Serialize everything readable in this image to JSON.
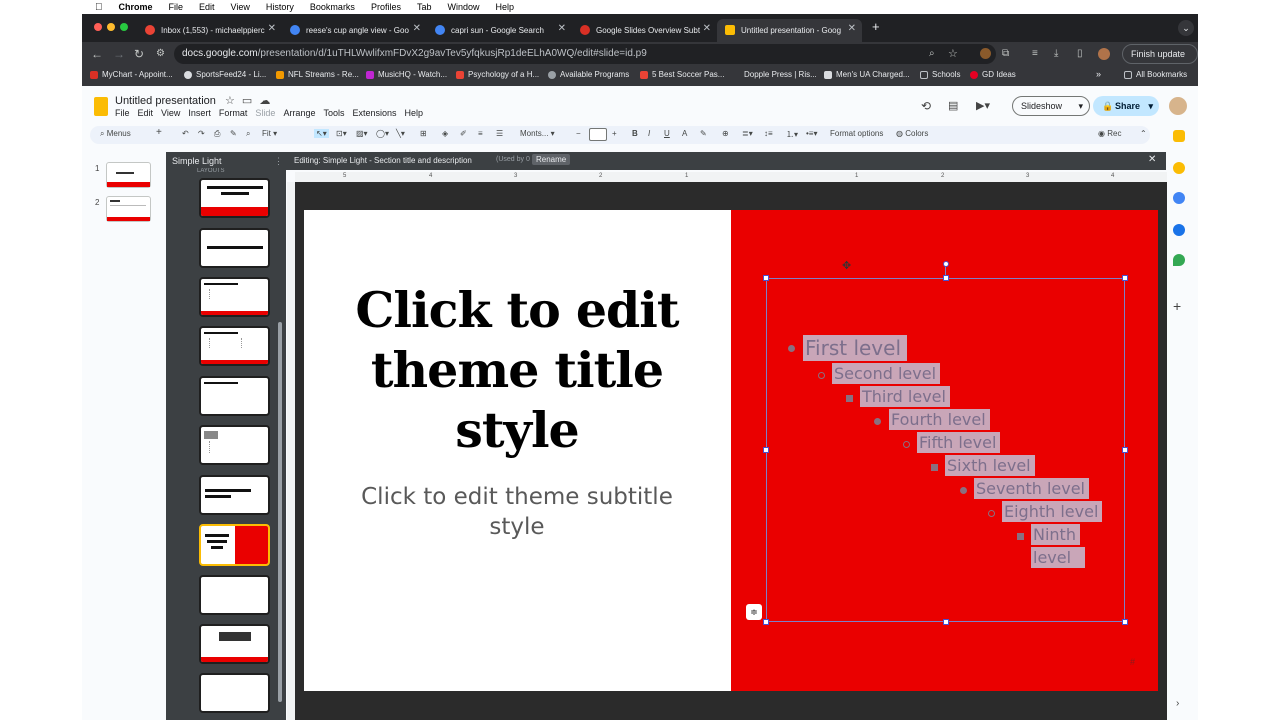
{
  "mac_menu": {
    "app": "Chrome",
    "items": [
      "File",
      "Edit",
      "View",
      "History",
      "Bookmarks",
      "Profiles",
      "Tab",
      "Window",
      "Help"
    ]
  },
  "tabs": [
    {
      "label": "Inbox (1,553) - michaelppierc",
      "color": "#ea4335"
    },
    {
      "label": "reese's cup angle view - Goo",
      "color": "#4285f4"
    },
    {
      "label": "capri sun - Google Search",
      "color": "#4285f4"
    },
    {
      "label": "Google Slides Overview Subt",
      "color": "#d93025"
    },
    {
      "label": "Untitled presentation - Goog",
      "color": "#fbbc04"
    }
  ],
  "omnibox": {
    "host": "docs.google.com",
    "path": "/presentation/d/1uTHLWwlifxmFDvX2g9avTev5yfqkusjRp1deELhA0WQ/edit#slide=id.p9"
  },
  "finish_update": "Finish update",
  "bookmarks": [
    "MyChart - Appoint...",
    "SportsFeed24 - Li...",
    "NFL Streams - Re...",
    "MusicHQ - Watch...",
    "Psychology of a H...",
    "Available Programs",
    "5 Best Soccer Pas...",
    "Dopple Press | Ris...",
    "Men's UA Charged...",
    "Schools",
    "GD Ideas"
  ],
  "all_bookmarks": "All Bookmarks",
  "doc": {
    "title": "Untitled presentation",
    "menus": [
      "File",
      "Edit",
      "View",
      "Insert",
      "Format",
      "Slide",
      "Arrange",
      "Tools",
      "Extensions",
      "Help"
    ],
    "slideshow": "Slideshow",
    "share": "Share"
  },
  "toolbar": {
    "menus": "Menus",
    "zoom": "Fit",
    "font": "Monts...",
    "format_options": "Format options",
    "colors": "Colors",
    "rec": "Rec"
  },
  "filmstrip": {
    "slides": [
      "1",
      "2"
    ]
  },
  "layouts": {
    "theme_name": "Simple Light",
    "section_label": "LAYOUTS"
  },
  "editing_bar": {
    "label": "Editing: Simple Light - Section title and description",
    "usage": "(Used by 0 slides)",
    "rename": "Rename"
  },
  "ruler_marks": [
    "5",
    "4",
    "3",
    "2",
    "1",
    "",
    "1",
    "2",
    "3",
    "4"
  ],
  "slide": {
    "title": "Click to edit theme title style",
    "subtitle": "Click to edit theme subtitle style",
    "levels": [
      "First level",
      "Second level",
      "Third level",
      "Fourth level",
      "Fifth level",
      "Sixth level",
      "Seventh level",
      "Eighth level",
      "Ninth",
      "level"
    ],
    "accent": "#ea0000"
  }
}
